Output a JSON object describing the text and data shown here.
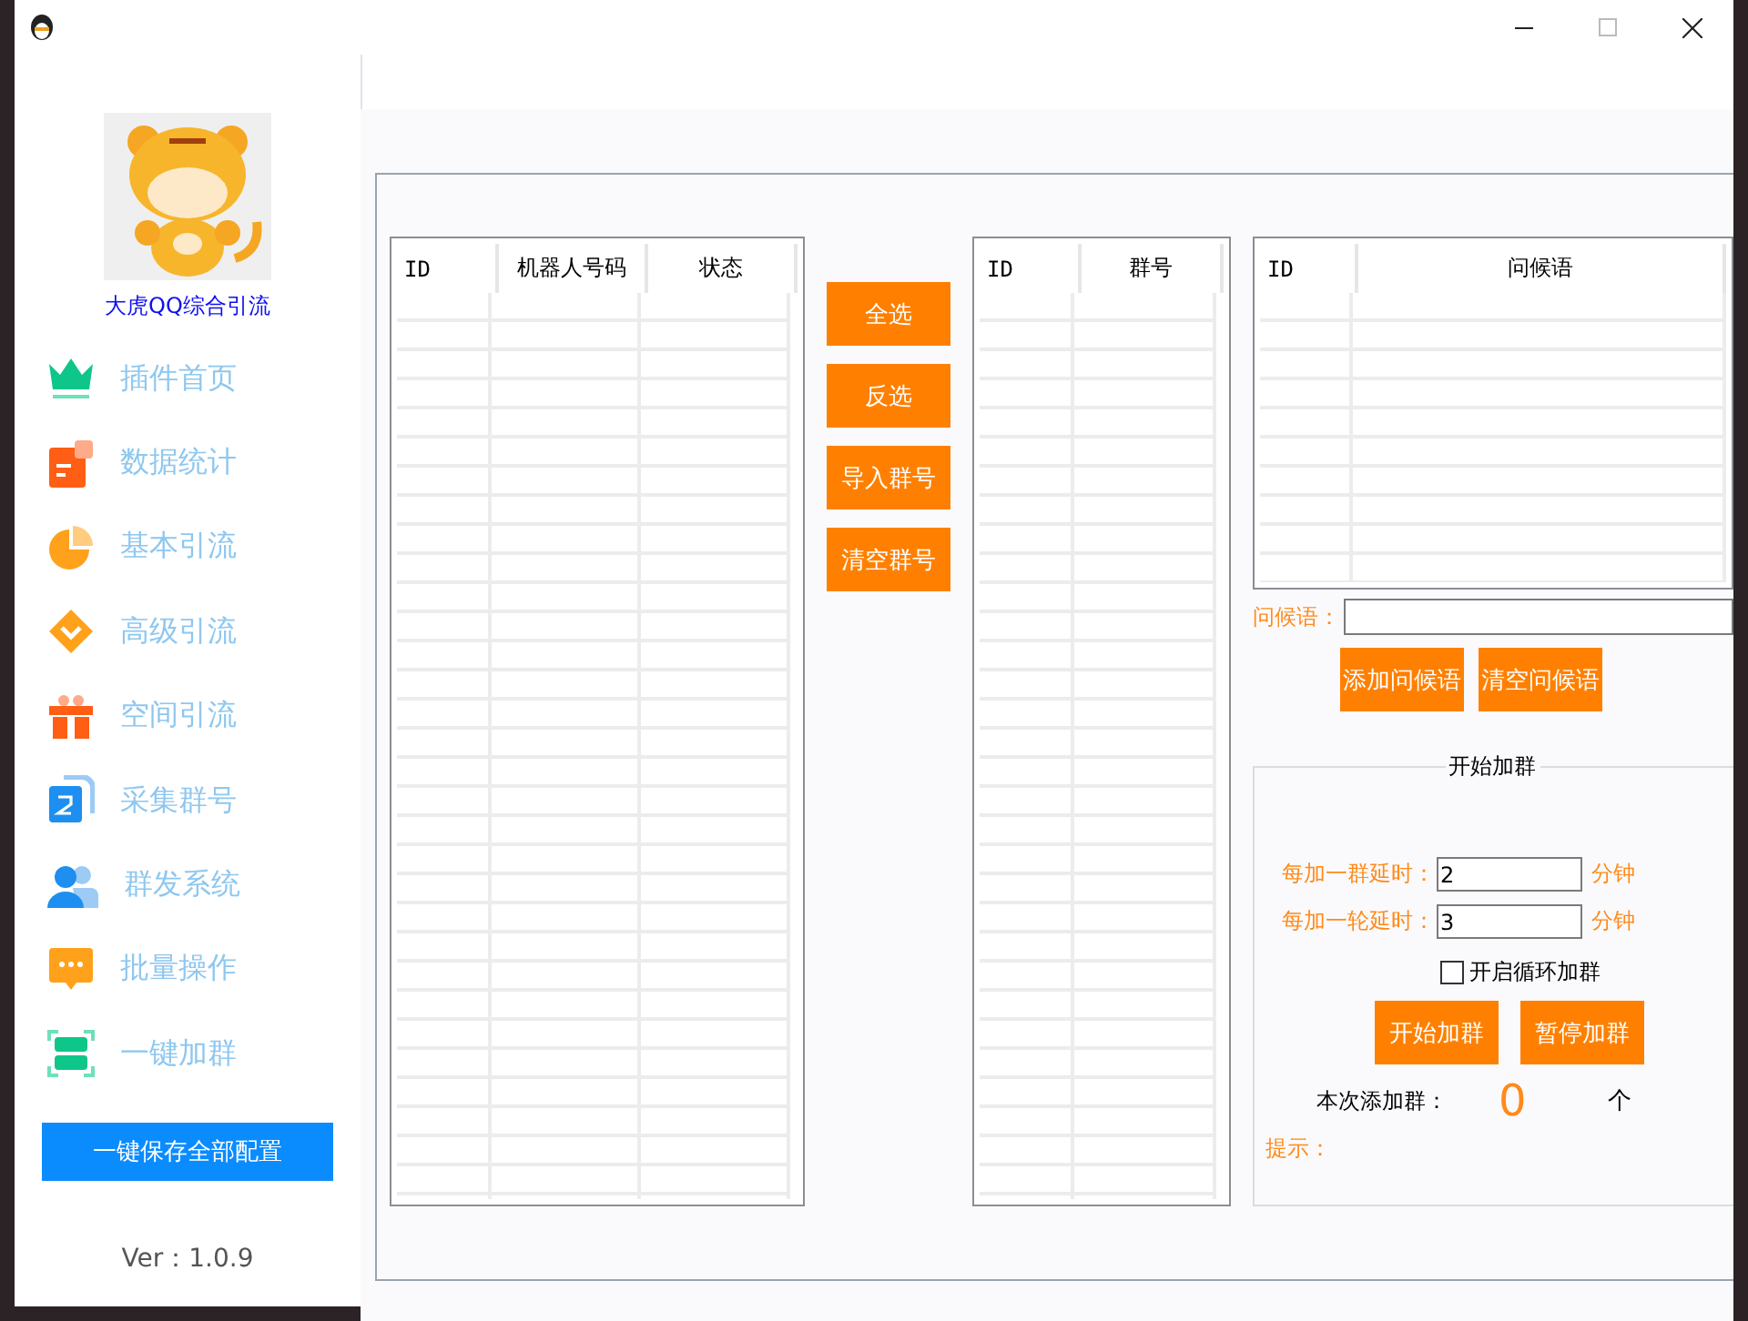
{
  "sidebar": {
    "brand": "大虎QQ综合引流",
    "items": [
      {
        "label": "插件首页"
      },
      {
        "label": "数据统计"
      },
      {
        "label": "基本引流"
      },
      {
        "label": "高级引流"
      },
      {
        "label": "空间引流"
      },
      {
        "label": "采集群号"
      },
      {
        "label": "群发系统"
      },
      {
        "label": "批量操作"
      },
      {
        "label": "一键加群"
      }
    ],
    "save_button": "一键保存全部配置",
    "version": "Ver：1.0.9"
  },
  "robot_table": {
    "columns": [
      "ID",
      "机器人号码",
      "状态"
    ]
  },
  "list_buttons": [
    "全选",
    "反选",
    "导入群号",
    "清空群号"
  ],
  "group_table": {
    "columns": [
      "ID",
      "群号"
    ]
  },
  "greeting_table": {
    "columns": [
      "ID",
      "问候语"
    ]
  },
  "greeting_field": {
    "label": "问候语："
  },
  "greeting_buttons": [
    "添加问候语",
    "清空问候语"
  ],
  "add_group": {
    "title": "开始加群",
    "delays": [
      {
        "label": "每加一群延时：",
        "value": "2",
        "unit": "分钟"
      },
      {
        "label": "每加一轮延时：",
        "value": "3",
        "unit": "分钟"
      }
    ],
    "loop": {
      "label": "开启循环加群",
      "checked": false
    },
    "buttons": [
      "开始加群",
      "暂停加群"
    ],
    "count": {
      "label": "本次添加群：",
      "value": "0",
      "unit": "个"
    },
    "hint": "提示："
  }
}
